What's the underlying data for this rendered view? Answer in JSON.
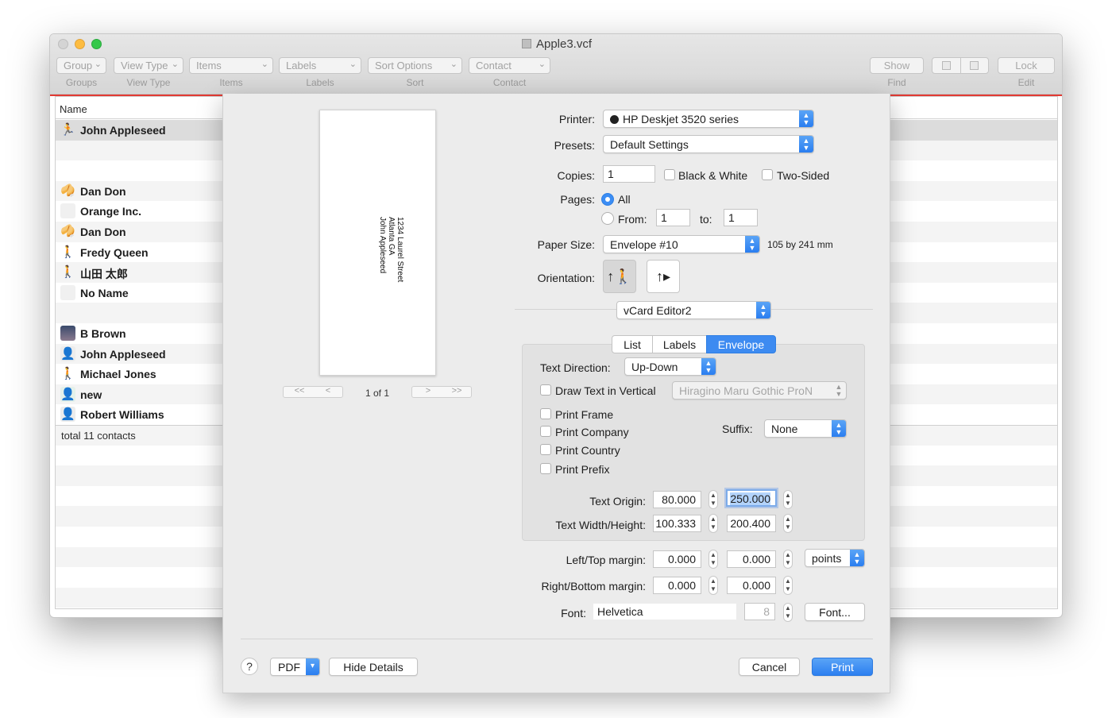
{
  "window": {
    "title": "Apple3.vcf",
    "traffic_colors": {
      "close": "#fc605c",
      "minimize": "#fdbc40",
      "zoom": "#34c84a"
    }
  },
  "toolbar": {
    "popups": [
      {
        "label": "Group",
        "caption": "Groups"
      },
      {
        "label": "View Type",
        "caption": "View Type"
      },
      {
        "label": "Items",
        "caption": "Items"
      },
      {
        "label": "Labels",
        "caption": "Labels"
      },
      {
        "label": "Sort Options",
        "caption": "Sort"
      },
      {
        "label": "Contact",
        "caption": "Contact"
      }
    ],
    "find": {
      "label": "Show",
      "caption": "Find"
    },
    "edit": {
      "label": "Lock",
      "caption": "Edit"
    }
  },
  "table": {
    "header": "Name",
    "contacts": [
      {
        "name": "John Appleseed",
        "icon": "runner-icon"
      },
      {
        "name": "",
        "icon": ""
      },
      {
        "name": "",
        "icon": ""
      },
      {
        "name": "Dan Don",
        "icon": "fortune-cookie-icon"
      },
      {
        "name": "Orange Inc.",
        "icon": "company-placeholder-icon"
      },
      {
        "name": "Dan Don",
        "icon": "fortune-cookie-icon"
      },
      {
        "name": "Fredy Queen",
        "icon": "person-silhouette-icon"
      },
      {
        "name": "山田 太郎",
        "icon": "person-silhouette-icon"
      },
      {
        "name": "No Name",
        "icon": "blank-placeholder-icon"
      },
      {
        "name": "",
        "icon": ""
      },
      {
        "name": "B Brown",
        "icon": "landscape-photo-icon"
      },
      {
        "name": "John Appleseed",
        "icon": "gray-person-icon"
      },
      {
        "name": "Michael Jones",
        "icon": "person-silhouette-icon"
      },
      {
        "name": "new",
        "icon": "green-person-icon"
      },
      {
        "name": "Robert Williams",
        "icon": "gray-person-icon"
      }
    ],
    "footer": "total 11 contacts"
  },
  "print": {
    "preview_lines": [
      "1234 Laurel Street",
      "Atlanta GA",
      "John Appleseed"
    ],
    "page_count": "1 of 1",
    "printer_label": "Printer:",
    "printer_value": "HP Deskjet 3520 series",
    "presets_label": "Presets:",
    "presets_value": "Default Settings",
    "copies_label": "Copies:",
    "copies_value": "1",
    "black_white_label": "Black & White",
    "two_sided_label": "Two-Sided",
    "pages_label": "Pages:",
    "pages_all_label": "All",
    "pages_from_label": "From:",
    "pages_from_value": "1",
    "pages_to_label": "to:",
    "pages_to_value": "1",
    "paper_size_label": "Paper Size:",
    "paper_size_value": "Envelope #10",
    "paper_dimensions": "105 by 241 mm",
    "orientation_label": "Orientation:",
    "app_pane_value": "vCard Editor2",
    "tabs": [
      "List",
      "Labels",
      "Envelope"
    ],
    "active_tab": "Envelope",
    "text_direction_label": "Text Direction:",
    "text_direction_value": "Up-Down",
    "draw_vertical_label": "Draw Text in Vertical",
    "vertical_font_value": "Hiragino Maru Gothic ProN",
    "print_frame_label": "Print Frame",
    "print_company_label": "Print Company",
    "print_country_label": "Print Country",
    "print_prefix_label": "Print Prefix",
    "suffix_label": "Suffix:",
    "suffix_value": "None",
    "text_origin_label": "Text Origin:",
    "text_origin_x": "80.000",
    "text_origin_y": "250.000",
    "text_wh_label": "Text Width/Height:",
    "text_width": "100.333",
    "text_height": "200.400",
    "left_top_margin_label": "Left/Top margin:",
    "left_margin": "0.000",
    "top_margin": "0.000",
    "units_value": "points",
    "right_bottom_margin_label": "Right/Bottom margin:",
    "right_margin": "0.000",
    "bottom_margin": "0.000",
    "font_label": "Font:",
    "font_value": "Helvetica",
    "font_size": "8",
    "font_button": "Font...",
    "help_button": "?",
    "pdf_button": "PDF",
    "hide_details_button": "Hide Details",
    "cancel_button": "Cancel",
    "print_button": "Print",
    "accent_color": "#3d8bf1"
  }
}
